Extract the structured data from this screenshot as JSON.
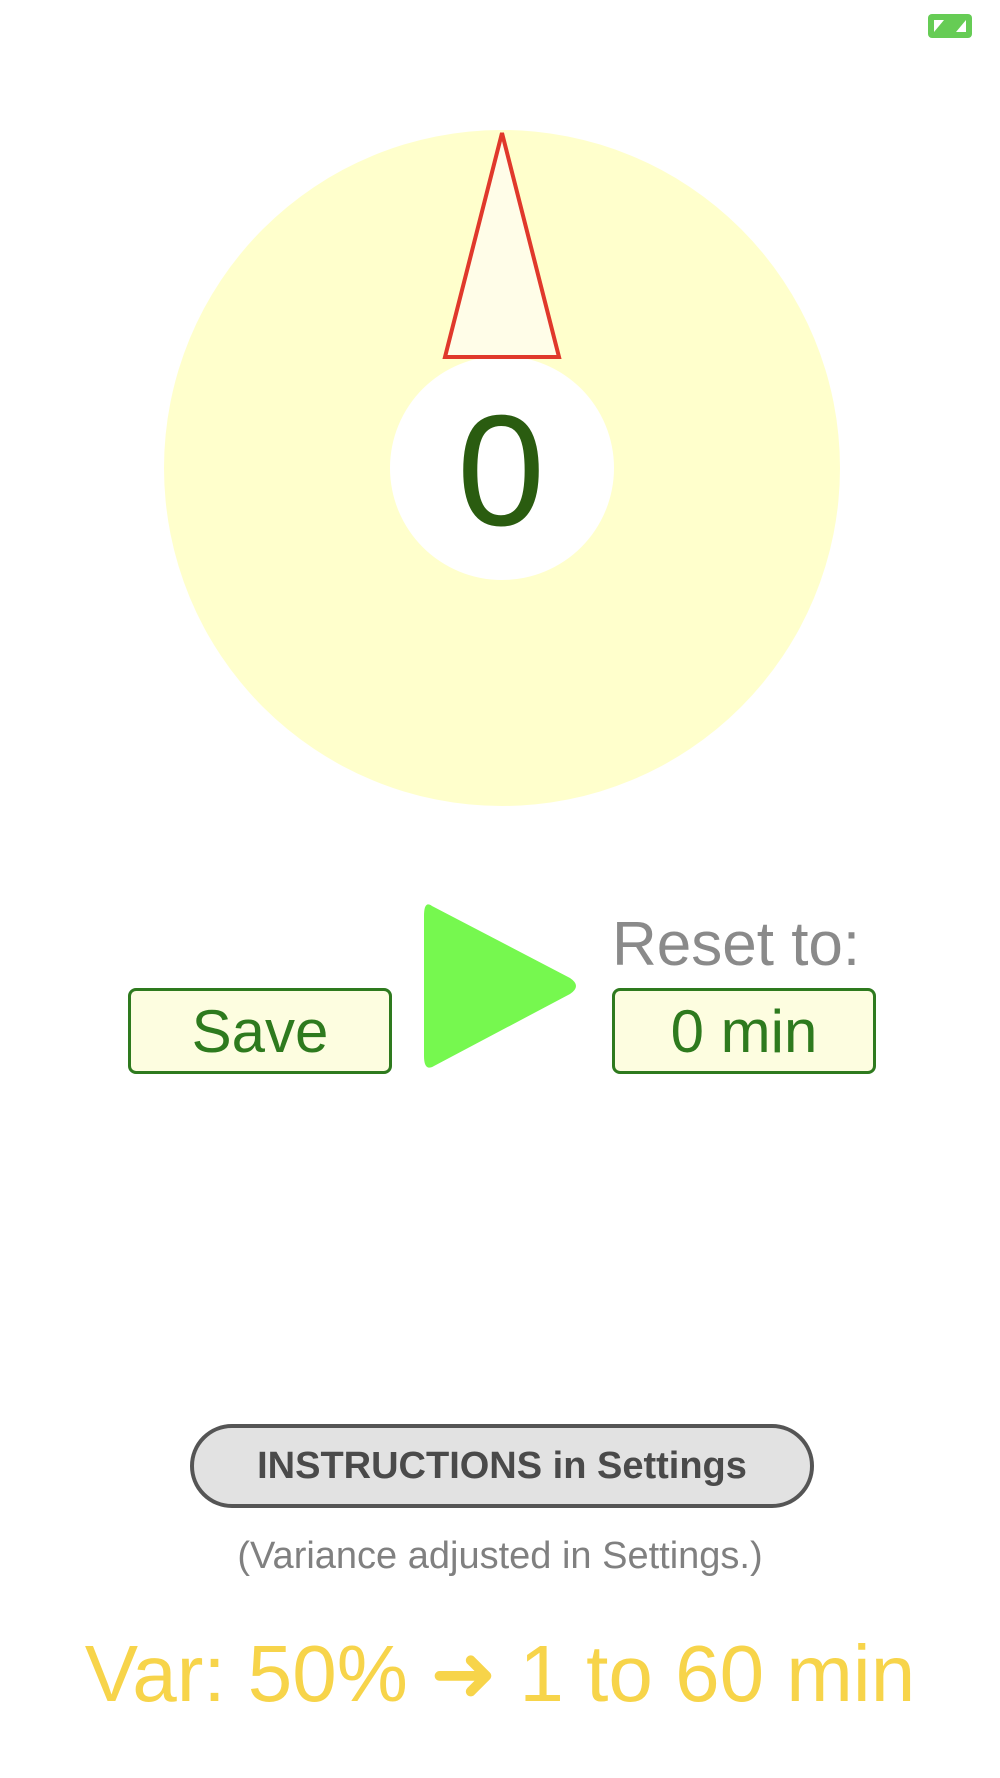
{
  "theme": {
    "dial_color": "#ffffcc",
    "pointer_stroke": "#e0392b",
    "pointer_fill": "#fffde8",
    "play_color": "#76f84f",
    "accent_green": "#2e7a1e",
    "summary_color": "#f7d44a"
  },
  "header": {
    "expand_icon": "expand-arrows-icon"
  },
  "dial": {
    "value": "0",
    "pointer_icon": "triangle-pointer"
  },
  "controls": {
    "save_label": "Save",
    "play_icon": "play-icon",
    "reset_label": "Reset to:",
    "reset_value": "0 min"
  },
  "settings": {
    "instructions_label": "INSTRUCTIONS in Settings",
    "variance_note": "(Variance adjusted in Settings.)",
    "variance_summary": "Var: 50% ➜ 1 to 60 min"
  }
}
